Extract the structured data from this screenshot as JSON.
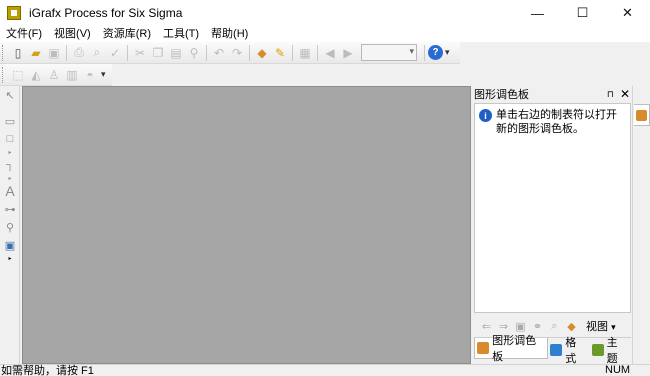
{
  "app": {
    "title": "iGrafx Process for Six Sigma"
  },
  "window_controls": {
    "minimize": "—",
    "maximize": "☐",
    "close": "✕"
  },
  "menu": [
    "文件(F)",
    "视图(V)",
    "资源库(R)",
    "工具(T)",
    "帮助(H)"
  ],
  "toolbar": {
    "buttons": [
      "new-icon",
      "open-icon",
      "save-icon",
      "print-icon",
      "print-preview-icon",
      "spell-check-icon",
      "cut-icon",
      "copy-icon",
      "paste-icon",
      "format-painter-icon",
      "undo-icon",
      "redo-icon",
      "palette-icon",
      "pencil-icon",
      "table-icon",
      "back-icon",
      "forward-icon",
      "zoom-combo",
      "help-icon"
    ],
    "overflow": "▾"
  },
  "drawing_toolbar": {
    "overflow": "▾"
  },
  "left_tools": [
    "pointer-icon",
    "shape-icon",
    "rectangle-icon",
    "connector-icon",
    "text-icon",
    "connector-tool-icon",
    "zoom-icon",
    "screen-icon"
  ],
  "palette_panel": {
    "title": "图形调色板",
    "pin": "⊓",
    "close": "✕",
    "message": "单击右边的制表符以打开新的图形调色板。",
    "view_menu": "视图",
    "view_menu_arrow": "▾",
    "tabs": [
      {
        "label": "图形调色板",
        "color": "#d98a2b"
      },
      {
        "label": "格式",
        "color": "#2f7fd1"
      },
      {
        "label": "主题",
        "color": "#6a9a2a"
      }
    ]
  },
  "statusbar": {
    "help_text": "如需帮助，请按 F1",
    "num_indicator": "NUM"
  }
}
